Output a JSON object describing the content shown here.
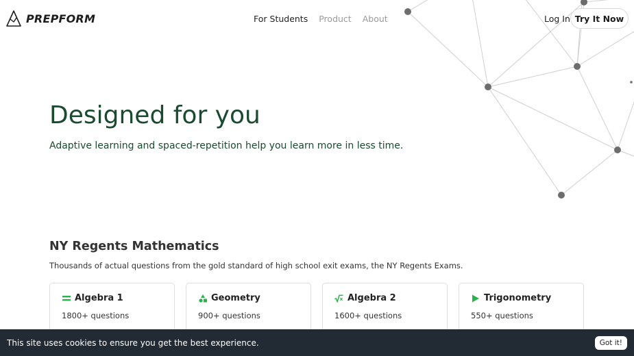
{
  "header": {
    "brand": "PREPFORM",
    "nav": [
      {
        "label": "For Students",
        "active": true
      },
      {
        "label": "Product",
        "active": false
      },
      {
        "label": "About",
        "active": false
      }
    ],
    "login_label": "Log In",
    "cta_label": "Try It Now"
  },
  "hero": {
    "title": "Designed for you",
    "subtitle": "Adaptive learning and spaced-repetition help you learn more in less time."
  },
  "section": {
    "title": "NY Regents Mathematics",
    "subtitle": "Thousands of actual questions from the gold standard of high school exit exams, the NY Regents Exams.",
    "cards": [
      {
        "icon": "equals-icon",
        "title": "Algebra 1",
        "count": "1800+ questions"
      },
      {
        "icon": "shapes-icon",
        "title": "Geometry",
        "count": "900+ questions"
      },
      {
        "icon": "square-root-icon",
        "title": "Algebra 2",
        "count": "1600+ questions"
      },
      {
        "icon": "play-triangle-icon",
        "title": "Trigonometry",
        "count": "550+ questions"
      }
    ]
  },
  "cookie": {
    "text": "This site uses cookies to ensure you get the best experience.",
    "button_label": "Got it!"
  },
  "colors": {
    "hero_text": "#1a4a30",
    "icon_green": "#2bb24c",
    "cookie_bg": "#222a33"
  }
}
